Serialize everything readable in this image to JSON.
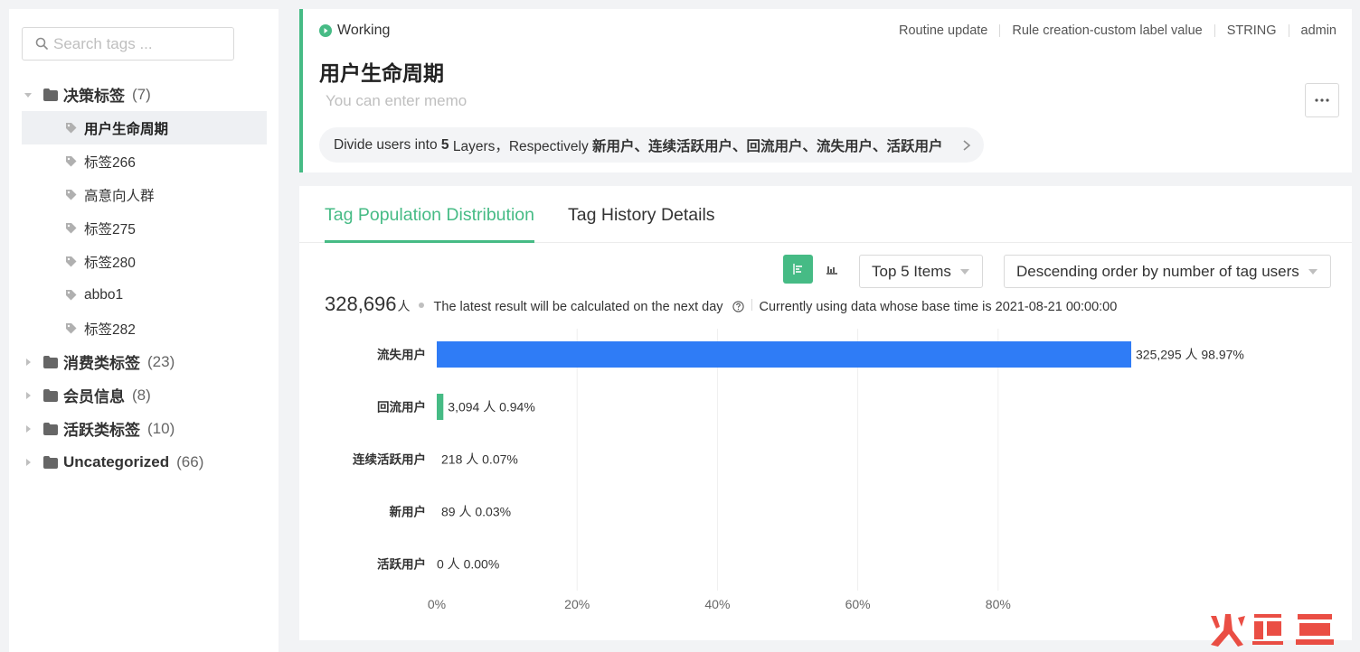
{
  "sidebar": {
    "search_placeholder": "Search tags ...",
    "groups": [
      {
        "name": "决策标签",
        "count": "(7)",
        "expanded": true
      },
      {
        "name": "消费类标签",
        "count": "(23)",
        "expanded": false
      },
      {
        "name": "会员信息",
        "count": "(8)",
        "expanded": false
      },
      {
        "name": "活跃类标签",
        "count": "(10)",
        "expanded": false
      },
      {
        "name": "Uncategorized",
        "count": "(66)",
        "expanded": false
      }
    ],
    "tags": [
      {
        "name": "用户生命周期",
        "active": true
      },
      {
        "name": "标签266",
        "active": false
      },
      {
        "name": "高意向人群",
        "active": false
      },
      {
        "name": "标签275",
        "active": false
      },
      {
        "name": "标签280",
        "active": false
      },
      {
        "name": "abbo1",
        "active": false
      },
      {
        "name": "标签282",
        "active": false
      }
    ]
  },
  "header": {
    "status": "Working",
    "meta": [
      "Routine update",
      "Rule creation-custom label value",
      "STRING",
      "admin"
    ],
    "title": "用户生命周期",
    "memo_placeholder": "You can enter memo",
    "desc_prefix": "Divide users into",
    "desc_count": "5",
    "desc_mid": "Layers，Respectively",
    "desc_layers": "新用户、连续活跃用户、回流用户、流失用户、活跃用户"
  },
  "tabs": [
    {
      "label": "Tag Population Distribution",
      "active": true
    },
    {
      "label": "Tag History Details",
      "active": false
    }
  ],
  "controls": {
    "top_select": "Top 5 Items",
    "order_select": "Descending order by number of tag users"
  },
  "summary": {
    "total": "328,696",
    "unit": "人",
    "note": "The latest result will be calculated on the next day",
    "base_time": "Currently using data whose base time is 2021-08-21 00:00:00"
  },
  "colors": {
    "accent": "#46bb85",
    "bar_primary": "#2f7cf6",
    "bar_secondary": "#46bb85"
  },
  "chart_data": {
    "type": "bar",
    "orientation": "horizontal",
    "categories": [
      "流失用户",
      "回流用户",
      "连续活跃用户",
      "新用户",
      "活跃用户"
    ],
    "values": [
      325295,
      3094,
      218,
      89,
      0
    ],
    "percent": [
      98.97,
      0.94,
      0.07,
      0.03,
      0.0
    ],
    "labels": [
      "325,295 人 98.97%",
      "3,094 人 0.94%",
      "218 人 0.07%",
      "89 人 0.03%",
      "0 人 0.00%"
    ],
    "x_ticks": [
      "0%",
      "20%",
      "40%",
      "60%",
      "80%"
    ],
    "xlim": [
      0,
      100
    ],
    "grid": true
  }
}
